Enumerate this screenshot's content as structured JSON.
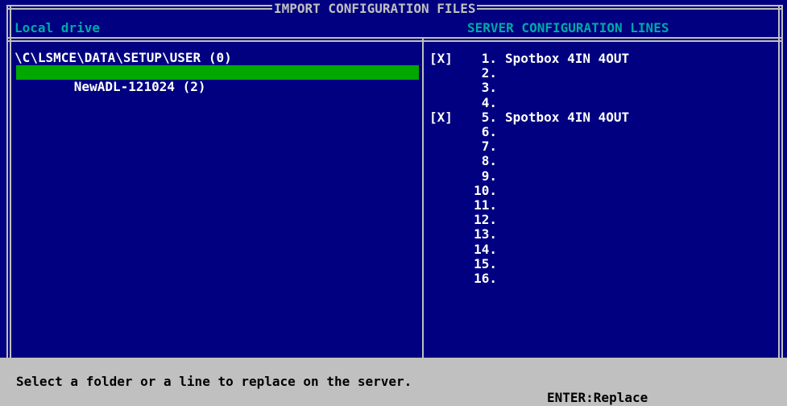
{
  "window": {
    "title": "IMPORT CONFIGURATION FILES",
    "left_header": "Local drive",
    "right_header": "SERVER CONFIGURATION LINES"
  },
  "tree": {
    "path": "\\C\\LSMCE\\DATA\\SETUP\\USER (0)",
    "selected_item": "NewADL-121024 (2)"
  },
  "server_lines": [
    {
      "mark": "[X]",
      "number": "1.",
      "name": "Spotbox 4IN 4OUT"
    },
    {
      "mark": "",
      "number": "2.",
      "name": ""
    },
    {
      "mark": "",
      "number": "3.",
      "name": ""
    },
    {
      "mark": "",
      "number": "4.",
      "name": ""
    },
    {
      "mark": "[X]",
      "number": "5.",
      "name": "Spotbox 4IN 4OUT"
    },
    {
      "mark": "",
      "number": "6.",
      "name": ""
    },
    {
      "mark": "",
      "number": "7.",
      "name": ""
    },
    {
      "mark": "",
      "number": "8.",
      "name": ""
    },
    {
      "mark": "",
      "number": "9.",
      "name": ""
    },
    {
      "mark": "",
      "number": "10.",
      "name": ""
    },
    {
      "mark": "",
      "number": "11.",
      "name": ""
    },
    {
      "mark": "",
      "number": "12.",
      "name": ""
    },
    {
      "mark": "",
      "number": "13.",
      "name": ""
    },
    {
      "mark": "",
      "number": "14.",
      "name": ""
    },
    {
      "mark": "",
      "number": "15.",
      "name": ""
    },
    {
      "mark": "",
      "number": "16.",
      "name": ""
    }
  ],
  "status": {
    "message": "Select a folder or a line to replace on the server.",
    "key_hint": "ENTER:Replace"
  },
  "colors": {
    "background": "#000080",
    "frame": "#c0c0c0",
    "header_text": "#00a8a8",
    "selection": "#00a800",
    "status_bar": "#c0c0c0"
  }
}
